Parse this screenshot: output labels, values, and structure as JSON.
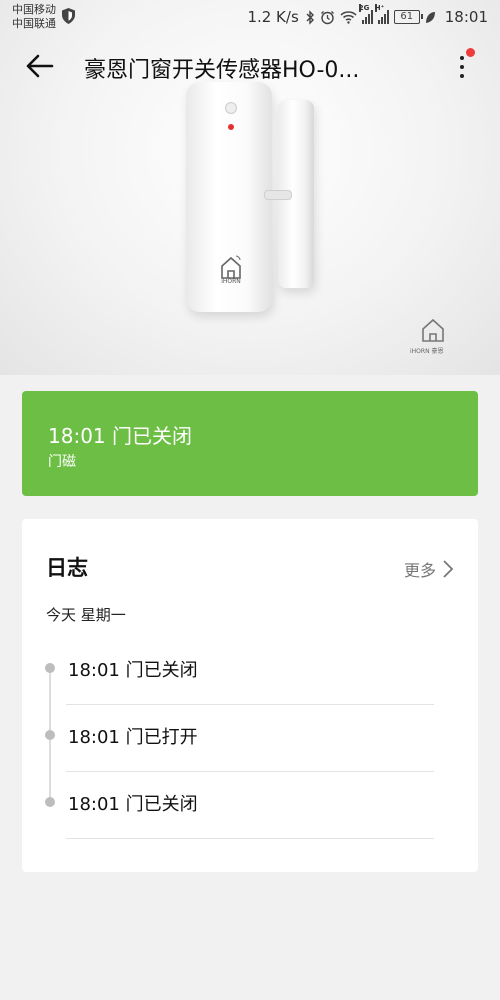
{
  "status_bar": {
    "carrier1": "中国移动",
    "carrier2": "中国联通",
    "net_speed": "1.2 K/s",
    "sig1_tag": "2G",
    "sig2_tag": "H⁺",
    "battery": "61",
    "time": "18:01"
  },
  "header": {
    "title": "豪恩门窗开关传感器HO-0..."
  },
  "device_image": {
    "brand": "iHORN",
    "corner_brand": "iHORN 豪恩"
  },
  "status_card": {
    "main_text": "18:01 门已关闭",
    "sub_text": "门磁",
    "color": "#6cbf44"
  },
  "log": {
    "title": "日志",
    "more_label": "更多",
    "day_label": "今天 星期一",
    "entries": [
      {
        "text": "18:01 门已关闭"
      },
      {
        "text": "18:01 门已打开"
      },
      {
        "text": "18:01 门已关闭"
      }
    ]
  },
  "colors": {
    "accent_red": "#f03b3b",
    "status_green": "#6cbf44"
  }
}
